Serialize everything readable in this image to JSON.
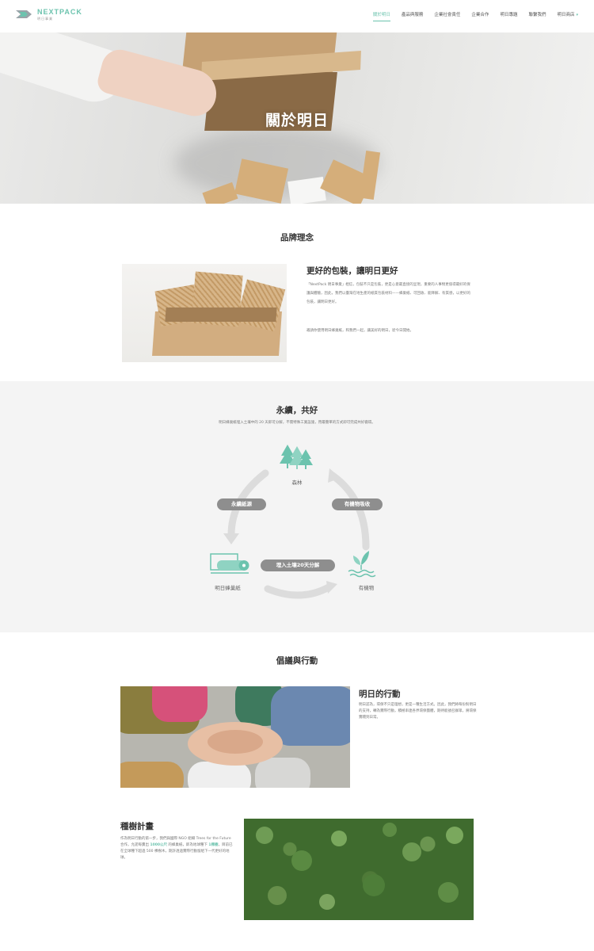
{
  "header": {
    "logo_name": "NEXTPACK",
    "logo_sub": "明日事業",
    "nav": [
      {
        "label": "關於明日",
        "active": true
      },
      {
        "label": "產品與服務",
        "active": false
      },
      {
        "label": "企業社會責任",
        "active": false
      },
      {
        "label": "企業合作",
        "active": false
      },
      {
        "label": "明日專題",
        "active": false
      },
      {
        "label": "聯繫我們",
        "active": false
      },
      {
        "label": "明日商店",
        "active": false
      }
    ],
    "shop_caret": "▾"
  },
  "hero": {
    "title": "關於明日"
  },
  "brand": {
    "section_title": "品牌理念",
    "heading": "更好的包裝，讓明日更好",
    "body": "「NextPack 明日事業」相信，包裝不只是包裝，更是心意最直接的呈現，重要的人事物更值得最好的保護與體驗，因此，我們以臺灣在地生產的紙質包裝材料——蜂巢紙、可回收、能降解、有質感，以更好的包裝，讓明日更好。",
    "body2": "邀請你使用明日蜂巢紙，和我們一起，讓美好的明日，從今日開始。"
  },
  "sustain": {
    "section_title": "永續，共好",
    "subtitle": "明日蜂巢紙埋入土壤中的 20 天即可分解，不需特殊工業設施，用最簡單的方式即可完成共好循環。",
    "forest_label": "森林",
    "organic_label": "有機物",
    "paper_label": "明日蜂巢紙",
    "pill_left": "永續紙源",
    "pill_right": "有機物吸收",
    "pill_bottom": "埋入土壤20天分解",
    "accent": "#6cc3ae",
    "arrow_color": "#dcdcdc"
  },
  "action": {
    "section_title": "倡議與行動",
    "heading": "明日的行動",
    "body": "明日認為，環保不只是理想，更是一種生活方式。因此，我們將每份對明日的支持，轉為實際行動，積極串連各界環保團體，期待能號召群眾，將環保實踐到日常。"
  },
  "trees": {
    "heading": "種樹計畫",
    "body_a": "作為明日行動的第一步，我們與國際 NGO 組織 Trees for the Future 合作，允諾每賣出 ",
    "body_hl1": "1000公尺",
    "body_b": " 的蜂巢紙，即為地球種下 ",
    "body_hl2": "1棵樹",
    "body_c": "，目前已在全球種下超過 500 棵樹木，期許透過實際行動留給下一代更好的地球。"
  }
}
